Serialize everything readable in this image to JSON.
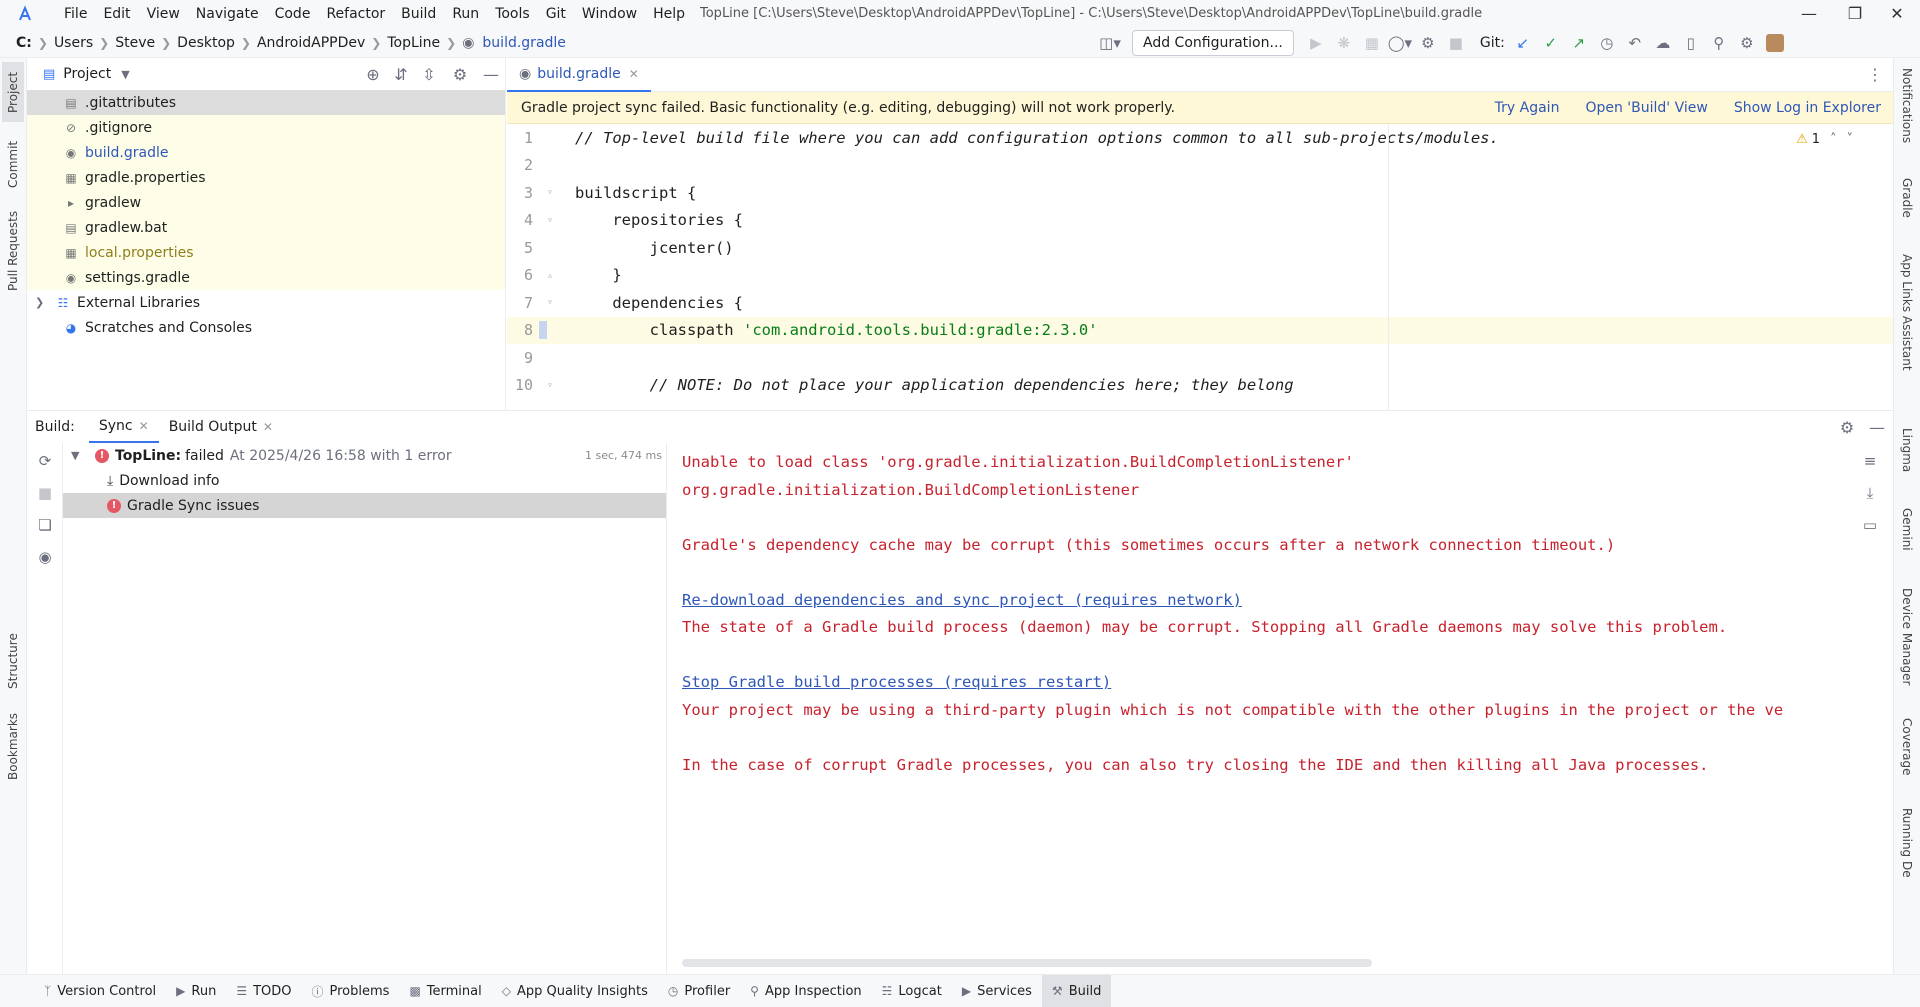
{
  "titlebar": {
    "menu": [
      "File",
      "Edit",
      "View",
      "Navigate",
      "Code",
      "Refactor",
      "Build",
      "Run",
      "Tools",
      "Git",
      "Window",
      "Help"
    ],
    "window_title": "TopLine [C:\\Users\\Steve\\Desktop\\AndroidAPPDev\\TopLine] - C:\\Users\\Steve\\Desktop\\AndroidAPPDev\\TopLine\\build.gradle"
  },
  "navbar": {
    "drive": "C:",
    "crumbs": [
      "Users",
      "Steve",
      "Desktop",
      "AndroidAPPDev",
      "TopLine"
    ],
    "file": "build.gradle",
    "add_configuration": "Add Configuration...",
    "git_label": "Git:"
  },
  "left_stripe": [
    "Project",
    "Commit",
    "Pull Requests",
    "Structure",
    "Bookmarks"
  ],
  "right_stripe": [
    "Notifications",
    "Gradle",
    "App Links Assistant",
    "Lingma",
    "Gemini",
    "Device Manager",
    "Coverage",
    "Running De"
  ],
  "project": {
    "title": "Project",
    "items": [
      {
        "name": ".gitattributes"
      },
      {
        "name": ".gitignore"
      },
      {
        "name": "build.gradle"
      },
      {
        "name": "gradle.properties"
      },
      {
        "name": "gradlew"
      },
      {
        "name": "gradlew.bat"
      },
      {
        "name": "local.properties"
      },
      {
        "name": "settings.gradle"
      },
      {
        "name": "External Libraries"
      },
      {
        "name": "Scratches and Consoles"
      }
    ]
  },
  "editor": {
    "tab": "build.gradle",
    "banner": {
      "message": "Gradle project sync failed. Basic functionality (e.g. editing, debugging) will not work properly.",
      "try_again": "Try Again",
      "open_build": "Open 'Build' View",
      "show_log": "Show Log in Explorer"
    },
    "warning_count": "1",
    "lines": [
      {
        "n": "1",
        "text": "// Top-level build file where you can add configuration options common to all sub-projects/modules."
      },
      {
        "n": "2",
        "text": ""
      },
      {
        "n": "3",
        "text": "buildscript {"
      },
      {
        "n": "4",
        "text": "    repositories {"
      },
      {
        "n": "5",
        "text": "        jcenter()"
      },
      {
        "n": "6",
        "text": "    }"
      },
      {
        "n": "7",
        "text": "    dependencies {"
      },
      {
        "n": "8",
        "pre": "        classpath ",
        "str": "'com.android.tools.build:gradle:2.3.0'"
      },
      {
        "n": "9",
        "text": ""
      },
      {
        "n": "10",
        "text": "        // NOTE: Do not place your application dependencies here; they belong"
      }
    ]
  },
  "build": {
    "label": "Build:",
    "tabs": [
      "Sync",
      "Build Output"
    ],
    "tree": {
      "root_name": "TopLine:",
      "root_status": "failed",
      "root_detail": "At 2025/4/26 16:58 with 1 error",
      "root_time": "1 sec, 474 ms",
      "download": "Download info",
      "issues": "Gradle Sync issues"
    },
    "console": [
      {
        "text": "Unable to load class 'org.gradle.initialization.BuildCompletionListener'",
        "kind": "err"
      },
      {
        "text": "org.gradle.initialization.BuildCompletionListener",
        "kind": "err"
      },
      {
        "text": "",
        "kind": "err"
      },
      {
        "text": "Gradle's dependency cache may be corrupt (this sometimes occurs after a network connection timeout.)",
        "kind": "err"
      },
      {
        "text": "",
        "kind": "err"
      },
      {
        "text": "Re-download dependencies and sync project (requires network)",
        "kind": "link"
      },
      {
        "text": "The state of a Gradle build process (daemon) may be corrupt. Stopping all Gradle daemons may solve this problem.",
        "kind": "err"
      },
      {
        "text": "",
        "kind": "err"
      },
      {
        "text": "Stop Gradle build processes (requires restart)",
        "kind": "link"
      },
      {
        "text": "Your project may be using a third-party plugin which is not compatible with the other plugins in the project or the ve",
        "kind": "err"
      },
      {
        "text": "",
        "kind": "err"
      },
      {
        "text": "In the case of corrupt Gradle processes, you can also try closing the IDE and then killing all Java processes.",
        "kind": "err"
      }
    ]
  },
  "statusbar": [
    "Version Control",
    "Run",
    "TODO",
    "Problems",
    "Terminal",
    "App Quality Insights",
    "Profiler",
    "App Inspection",
    "Logcat",
    "Services",
    "Build"
  ]
}
